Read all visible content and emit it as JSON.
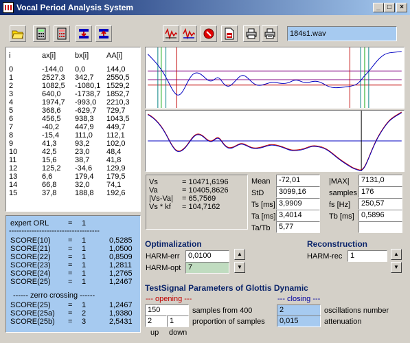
{
  "window": {
    "title": "Vocal Period Analysis System",
    "min": "_",
    "max": "□",
    "close": "×"
  },
  "toolbar": {
    "filename": "184s1.wav"
  },
  "table": {
    "headers": [
      "i",
      "ax[i]",
      "bx[i]",
      "AA[i]"
    ],
    "rows": [
      [
        "0",
        "-144,0",
        "0,0",
        "144,0"
      ],
      [
        "1",
        "2527,3",
        "342,7",
        "2550,5"
      ],
      [
        "2",
        "1082,5",
        "-1080,1",
        "1529,2"
      ],
      [
        "3",
        "640,0",
        "-1738,7",
        "1852,7"
      ],
      [
        "4",
        "1974,7",
        "-993,0",
        "2210,3"
      ],
      [
        "5",
        "368,6",
        "-629,7",
        "729,7"
      ],
      [
        "6",
        "456,5",
        "938,3",
        "1043,5"
      ],
      [
        "7",
        "-40,2",
        "447,9",
        "449,7"
      ],
      [
        "8",
        "-15,4",
        "111,0",
        "112,1"
      ],
      [
        "9",
        "41,3",
        "93,2",
        "102,0"
      ],
      [
        "10",
        "42,5",
        "23,0",
        "48,4"
      ],
      [
        "11",
        "15,6",
        "38,7",
        "41,8"
      ],
      [
        "12",
        "125,2",
        "-34,6",
        "129,9"
      ],
      [
        "13",
        "6,6",
        "179,4",
        "179,5"
      ],
      [
        "14",
        "66,8",
        "32,0",
        "74,1"
      ],
      [
        "15",
        "37,8",
        "188,8",
        "192,6"
      ]
    ]
  },
  "scores": {
    "expert": {
      "label": "expert ORL",
      "eq": "=",
      "value": "1"
    },
    "separator1": "------------------------------------",
    "items": [
      {
        "label": "SCORE(10)",
        "eq": "=",
        "cls": "1",
        "val": "0,5285"
      },
      {
        "label": "SCORE(21)",
        "eq": "=",
        "cls": "1",
        "val": "1,0500"
      },
      {
        "label": "SCORE(22)",
        "eq": "=",
        "cls": "1",
        "val": "0,8509"
      },
      {
        "label": "SCORE(23)",
        "eq": "=",
        "cls": "1",
        "val": "1,2811"
      },
      {
        "label": "SCORE(24)",
        "eq": "=",
        "cls": "1",
        "val": "1,2765"
      },
      {
        "label": "SCORE(25)",
        "eq": "=",
        "cls": "1",
        "val": "1,2467"
      }
    ],
    "zero_crossing": "------ zerro crossing ------",
    "items2": [
      {
        "label": "SCORE(25)",
        "eq": "=",
        "cls": "1",
        "val": "1,2467"
      },
      {
        "label": "SCORE(25a)",
        "eq": "=",
        "cls": "2",
        "val": "1,9380"
      },
      {
        "label": "SCORE(25b)",
        "eq": "=",
        "cls": "3",
        "val": "2,5431"
      }
    ]
  },
  "vs_panel": {
    "rows": [
      {
        "label": "Vs",
        "val": "= 10471,6196"
      },
      {
        "label": "Va",
        "val": "= 10405,8626"
      },
      {
        "label": "|Vs-Va|",
        "val": "= 65,7569"
      },
      {
        "label": "Vs * kf",
        "val": "= 104,7162"
      }
    ]
  },
  "stats": {
    "mean_label": "Mean",
    "mean": "-72,01",
    "std_label": "StD",
    "std": "3099,16",
    "ts_label": "Ts [ms]",
    "ts": "3,9909",
    "ta_label": "Ta [ms]",
    "ta": "3,4014",
    "tatb_label": "Ta/Tb",
    "tatb": "5,77",
    "max_label": "|MAX|",
    "max": "7131,0",
    "samples_label": "samples",
    "samples": "176",
    "fs_label": "fs [Hz]",
    "fs": "250,57",
    "tb_label": "Tb [ms]",
    "tb": "0,5896",
    "extra": ""
  },
  "optimalization": {
    "title": "Optimalization",
    "err_label": "HARM-err",
    "err_value": "0,0100",
    "opt_label": "HARM-opt",
    "opt_value": "7"
  },
  "reconstruction": {
    "title": "Reconstruction",
    "rec_label": "HARM-rec",
    "rec_value": "1"
  },
  "testsignal": {
    "title": "TestSignal Parameters of Glottis Dynamic",
    "opening": "--- opening ---",
    "closing": "--- closing ---",
    "samples_value": "150",
    "samples_label": "samples from 400",
    "up_value": "2",
    "down_value": "1",
    "proportion_label": "proportion of samples",
    "up_label": "up",
    "down_label": "down",
    "osc_value": "2",
    "osc_label": "oscillations number",
    "att_value": "0,015",
    "att_label": "attenuation"
  },
  "colors": {
    "panel_blue": "#a6caf0",
    "plot_blue": "#0000c0",
    "plot_red": "#c00000",
    "marker_green": "#00a000",
    "marker_teal": "#008080"
  }
}
